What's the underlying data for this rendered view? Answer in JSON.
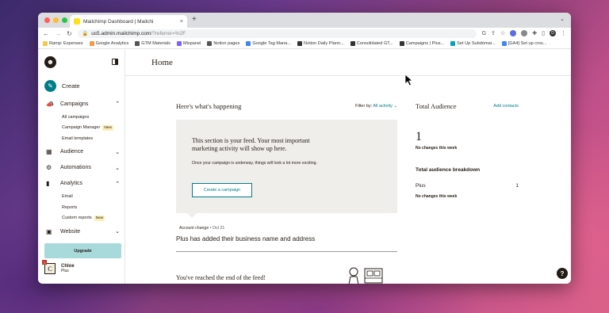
{
  "browser": {
    "tab_title": "Mailchimp Dashboard | Mailchi",
    "tab_close": "×",
    "new_tab": "+",
    "url_host": "us5.admin.mailchimp.com",
    "url_path": "/?referrer=%2F",
    "bookmarks": [
      {
        "label": "Ramp: Expenses",
        "color": "#f2c94c"
      },
      {
        "label": "Google Analytics",
        "color": "#f2994a"
      },
      {
        "label": "GTM Materials",
        "color": "#555"
      },
      {
        "label": "Mixpanel",
        "color": "#7b61ff"
      },
      {
        "label": "Notion pages",
        "color": "#555"
      },
      {
        "label": "Google Tag Mana...",
        "color": "#4285f4"
      },
      {
        "label": "Notion Daily Plann...",
        "color": "#333"
      },
      {
        "label": "Consolidated GT...",
        "color": "#333"
      },
      {
        "label": "Campaigns | Plus...",
        "color": "#333"
      },
      {
        "label": "Set Up Subdomai...",
        "color": "#00a4bd"
      },
      {
        "label": "[GA4] Set up cros...",
        "color": "#4285f4"
      }
    ],
    "profile_initial": "D"
  },
  "sidebar": {
    "create_label": "Create",
    "items": [
      {
        "label": "Campaigns",
        "icon": "megaphone-icon",
        "glyph": "📣",
        "chev": "⌃"
      },
      {
        "label": "Audience",
        "icon": "audience-icon",
        "glyph": "▦",
        "chev": "⌄"
      },
      {
        "label": "Automations",
        "icon": "automations-icon",
        "glyph": "⚙",
        "chev": "⌄"
      },
      {
        "label": "Analytics",
        "icon": "analytics-icon",
        "glyph": "▮",
        "chev": "⌃"
      },
      {
        "label": "Website",
        "icon": "website-icon",
        "glyph": "▣",
        "chev": "⌄"
      }
    ],
    "campaigns_sub": [
      "All campaigns",
      "Campaign Manager",
      "Email templates"
    ],
    "analytics_sub": [
      "Email",
      "Reports",
      "Custom reports"
    ],
    "new_badge": "New",
    "upgrade_label": "Upgrade",
    "user_initial": "C",
    "user_name": "Chloe",
    "user_plan": "Plus",
    "notif_count": "1"
  },
  "main": {
    "page_title": "Home",
    "feed_title": "Here's what's happening",
    "filter_prefix": "Filter by:",
    "filter_value": "All activity",
    "card_heading": "This section is your feed. Your most important marketing activity will show up here.",
    "card_small": "Once your campaign is underway, things will look a lot more exciting.",
    "create_campaign": "Create a campaign",
    "account_change": "Account change",
    "account_change_date": "• Oct 21",
    "account_change_title": "Plus has added their business name and address",
    "end_of_feed": "You've reached the end of the feed!",
    "audience_title": "Total Audience",
    "add_contacts": "Add contacts",
    "total_count": "1",
    "no_changes": "No changes this week",
    "breakdown_title": "Total audience breakdown",
    "plus_label": "Plus",
    "plus_count": "1",
    "help": "?"
  },
  "colors": {
    "accent": "#007c89",
    "upgrade_bg": "#a8dadc",
    "card_bg": "#efeeea"
  }
}
